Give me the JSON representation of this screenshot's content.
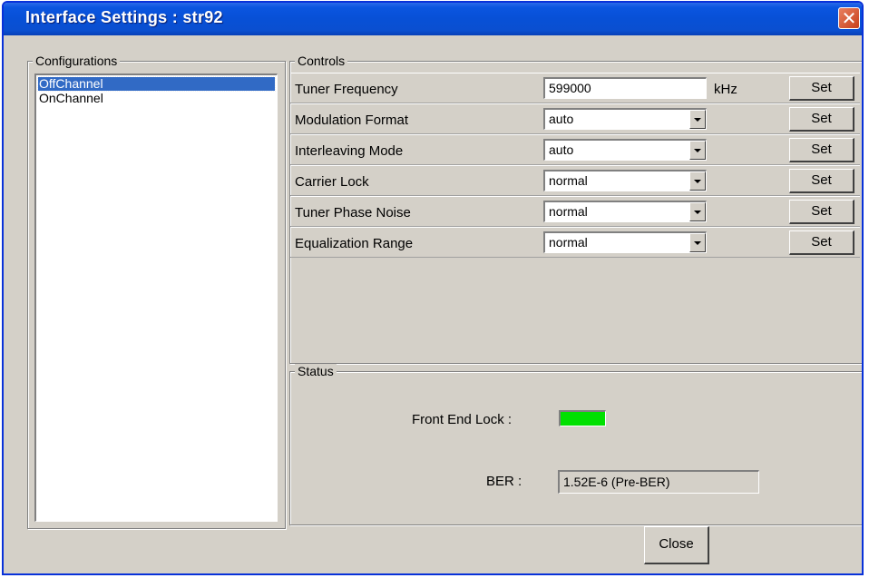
{
  "window": {
    "title": "Interface Settings : str92"
  },
  "configurations": {
    "legend": "Configurations",
    "items": [
      "OffChannel",
      "OnChannel"
    ],
    "selected": "OffChannel"
  },
  "controls": {
    "legend": "Controls",
    "set_label": "Set",
    "rows": [
      {
        "label": "Tuner Frequency",
        "type": "text",
        "value": "599000",
        "unit": "kHz"
      },
      {
        "label": "Modulation Format",
        "type": "dropdown",
        "value": "auto"
      },
      {
        "label": "Interleaving Mode",
        "type": "dropdown",
        "value": "auto"
      },
      {
        "label": "Carrier Lock",
        "type": "dropdown",
        "value": "normal"
      },
      {
        "label": "Tuner Phase Noise",
        "type": "dropdown",
        "value": "normal"
      },
      {
        "label": "Equalization Range",
        "type": "dropdown",
        "value": "normal"
      }
    ]
  },
  "status": {
    "legend": "Status",
    "front_end_lock_label": "Front End Lock :",
    "front_end_lock_color": "#00e000",
    "ber_label": "BER :",
    "ber_value": "1.52E-6 (Pre-BER)"
  },
  "footer": {
    "close_label": "Close"
  },
  "icons": {
    "title_close": "close-icon",
    "dropdown": "chevron-down-icon"
  }
}
